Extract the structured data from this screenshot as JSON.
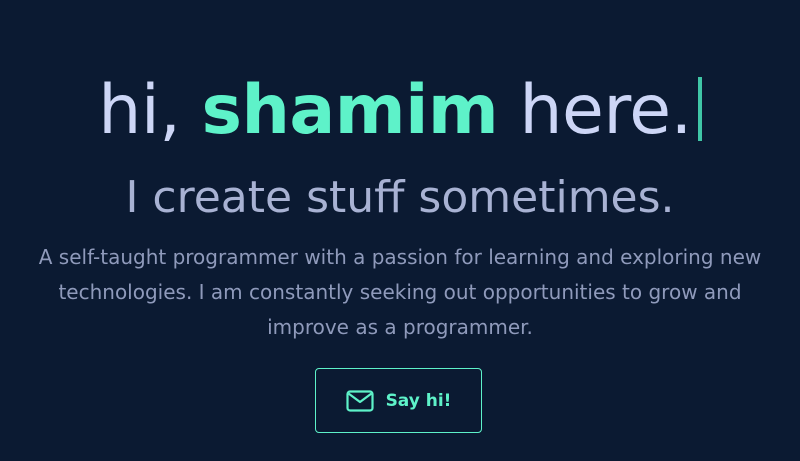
{
  "hero": {
    "greeting_prefix": "hi, ",
    "name": "shamim",
    "greeting_suffix": " here.",
    "tagline": "I create stuff sometimes.",
    "bio": "A self-taught programmer with a passion for learning and exploring new technologies. I am constantly seeking out opportunities to grow and improve as a programmer.",
    "cta": {
      "label": "Say hi!",
      "icon": "mail-icon"
    }
  },
  "colors": {
    "background": "#0b1a32",
    "accent": "#5ef2c9",
    "heading": "#cdd6f6",
    "subtitle": "#a8b2d3",
    "body": "#8f9abb"
  }
}
